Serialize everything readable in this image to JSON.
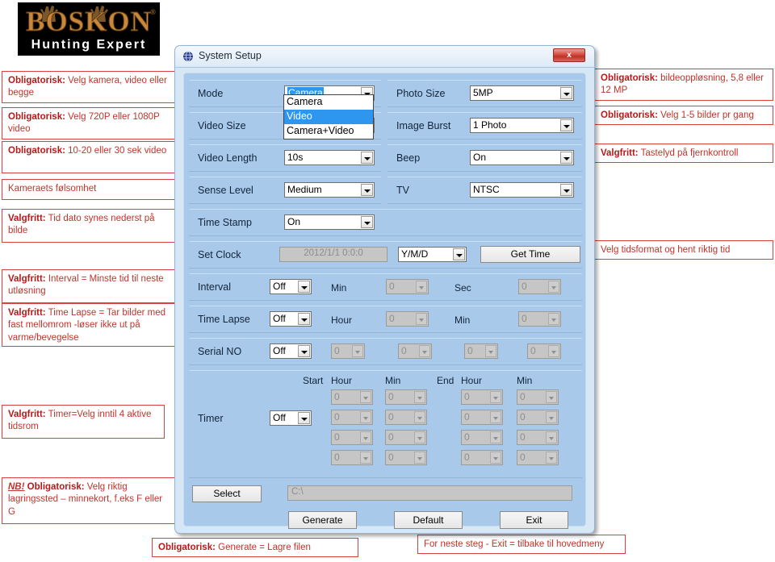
{
  "logo": {
    "brand": "BOSKON",
    "tagline": "Hunting Expert",
    "registered": "®"
  },
  "dialog": {
    "title": "System Setup",
    "title_icon": "globe-icon",
    "close_label": "x",
    "colors": {
      "panel_bg": "#a9c9ea",
      "window_bg": "#d8e7f6",
      "highlight": "#2f96f0",
      "annotation_red": "#c0342b",
      "close_red": "#bf3228"
    },
    "fields": {
      "mode": {
        "label": "Mode",
        "value": "Camera"
      },
      "video_size": {
        "label": "Video Size",
        "value": ""
      },
      "video_length": {
        "label": "Video Length",
        "value": "10s"
      },
      "sense_level": {
        "label": "Sense Level",
        "value": "Medium"
      },
      "time_stamp": {
        "label": "Time Stamp",
        "value": "On"
      },
      "set_clock": {
        "label": "Set Clock",
        "value": "2012/1/1  0:0:0"
      },
      "date_format": {
        "label": "",
        "value": "Y/M/D"
      },
      "photo_size": {
        "label": "Photo Size",
        "value": "5MP"
      },
      "image_burst": {
        "label": "Image Burst",
        "value": "1 Photo"
      },
      "beep": {
        "label": "Beep",
        "value": "On"
      },
      "tv": {
        "label": "TV",
        "value": "NTSC"
      },
      "interval": {
        "label": "Interval",
        "value": "Off",
        "unit1": "Min",
        "val1": "0",
        "unit2": "Sec",
        "val2": "0"
      },
      "time_lapse": {
        "label": "Time Lapse",
        "value": "Off",
        "unit1": "Hour",
        "val1": "0",
        "unit2": "Min",
        "val2": "0"
      },
      "serial_no": {
        "label": "Serial NO",
        "value": "Off",
        "v1": "0",
        "v2": "0",
        "v3": "0",
        "v4": "0"
      },
      "timer": {
        "label": "Timer",
        "value": "Off"
      },
      "path": {
        "value": "C:\\"
      }
    },
    "mode_dropdown": {
      "open": true,
      "options": [
        "Camera",
        "Video",
        "Camera+Video"
      ],
      "selected_index": 1
    },
    "timer_headers": [
      "Start",
      "Hour",
      "Min",
      "End",
      "Hour",
      "Min"
    ],
    "timer_rows": [
      [
        "0",
        "0",
        "0",
        "0"
      ],
      [
        "0",
        "0",
        "0",
        "0"
      ],
      [
        "0",
        "0",
        "0",
        "0"
      ],
      [
        "0",
        "0",
        "0",
        "0"
      ]
    ],
    "buttons": {
      "get_time": "Get Time",
      "select": "Select",
      "generate": "Generate",
      "default": "Default",
      "exit": "Exit"
    }
  },
  "annotations": {
    "left": [
      {
        "strong": "Obligatorisk:",
        "text": " Velg kamera, video eller begge"
      },
      {
        "strong": "Obligatorisk:",
        "text": " Velg 720P eller 1080P video"
      },
      {
        "strong": "Obligatorisk:",
        "text": " 10-20 eller 30 sek video"
      },
      {
        "strong": "",
        "text": "Kameraets følsomhet"
      },
      {
        "strong": "Valgfritt:",
        "text": " Tid dato synes nederst på bilde"
      },
      {
        "strong": "Valgfritt:",
        "text": " Interval = Minste tid til neste utløsning"
      },
      {
        "strong": "Valgfritt:",
        "text": " Time Lapse = Tar bilder med fast mellomrom -løser ikke ut på varme/bevegelse"
      },
      {
        "strong": "Valgfritt:",
        "text": " Timer=Velg inntil 4 aktive tidsrom"
      },
      {
        "nb": "NB!",
        "strong": " Obligatorisk:",
        "text": " Velg riktig lagringssted  – minnekort,  f.eks  F eller G"
      }
    ],
    "right": [
      {
        "strong": "Obligatorisk:",
        "text": " bildeoppløsning, 5,8 eller 12 MP"
      },
      {
        "strong": "Obligatorisk:",
        "text": " Velg 1-5 bilder pr gang"
      },
      {
        "strong": "Valgfritt:",
        "text": " Tastelyd på fjernkontroll"
      },
      {
        "strong": "",
        "text": "Velg tidsformat og hent riktig tid"
      }
    ],
    "bottom": [
      {
        "strong": "Obligatorisk:",
        "text": " Generate = Lagre filen"
      },
      {
        "strong": "",
        "text": "For neste steg - Exit = tilbake til hovedmeny"
      }
    ]
  }
}
